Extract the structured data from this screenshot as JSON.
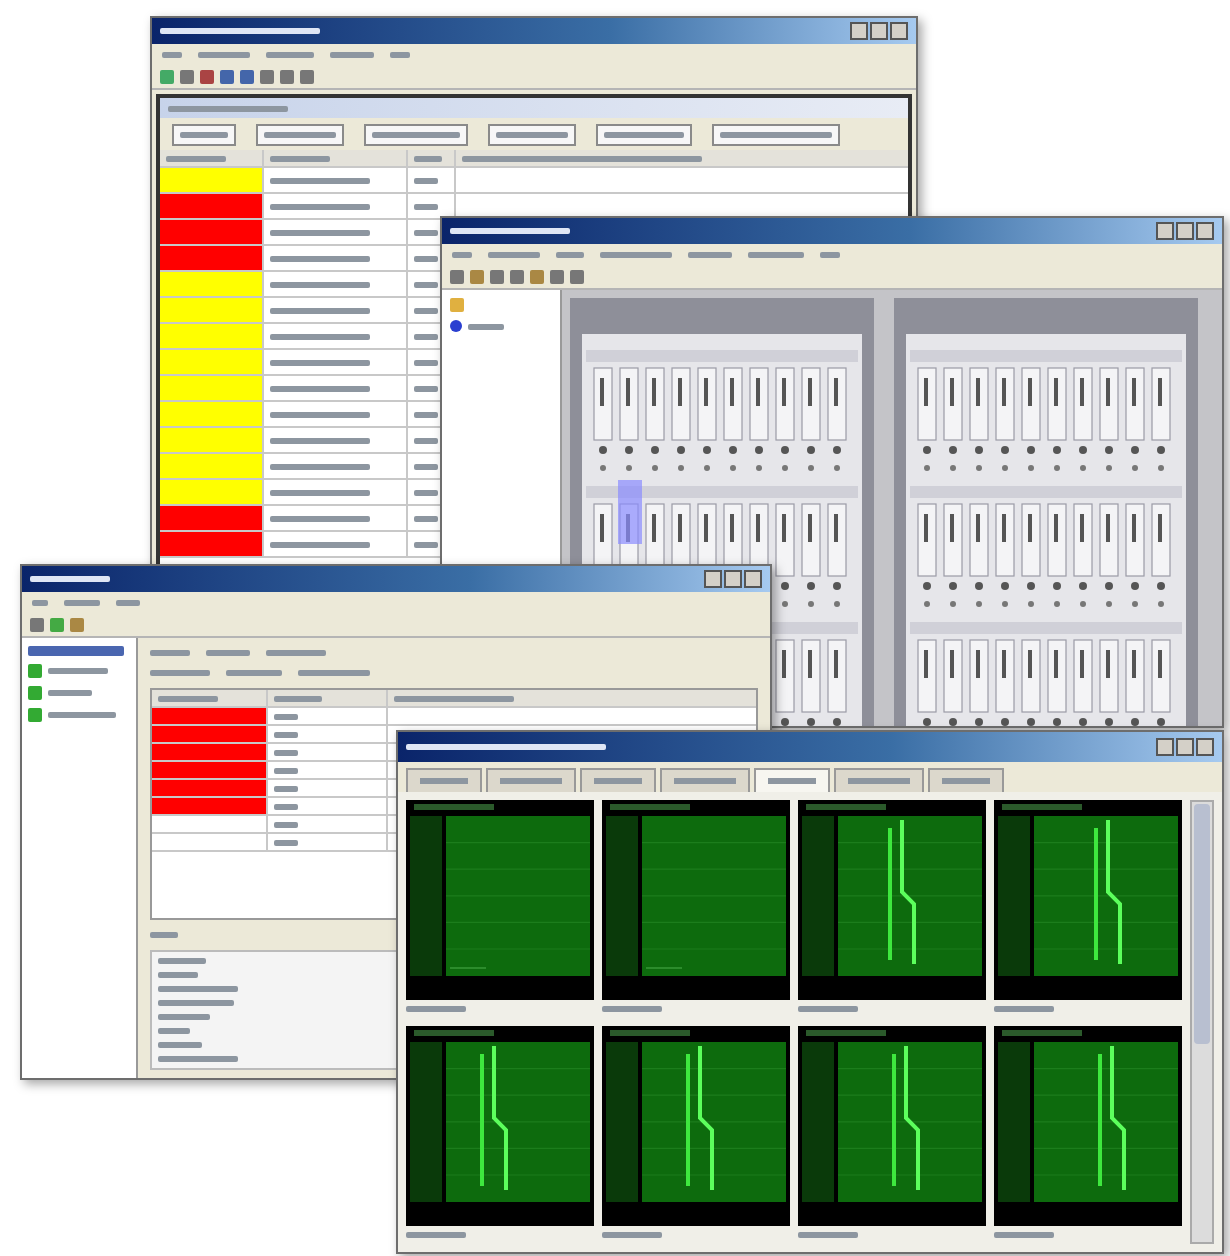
{
  "alarm_window": {
    "rows": [
      {
        "color": "#ffff00"
      },
      {
        "color": "#ff0000"
      },
      {
        "color": "#ff0000"
      },
      {
        "color": "#ff0000"
      },
      {
        "color": "#ffff00"
      },
      {
        "color": "#ffff00"
      },
      {
        "color": "#ffff00"
      },
      {
        "color": "#ffff00"
      },
      {
        "color": "#ffff00"
      },
      {
        "color": "#ffff00"
      },
      {
        "color": "#ffff00"
      },
      {
        "color": "#ffff00"
      },
      {
        "color": "#ffff00"
      },
      {
        "color": "#ff0000"
      },
      {
        "color": "#ff0000"
      }
    ]
  },
  "network_window": {
    "rows": [
      {
        "color": "#ff0000"
      },
      {
        "color": "#ff0000"
      },
      {
        "color": "#ff0000"
      },
      {
        "color": "#ff0000"
      },
      {
        "color": "#ff0000"
      },
      {
        "color": "#ff0000"
      },
      {
        "color": "#ffffff"
      },
      {
        "color": "#ffffff"
      }
    ]
  },
  "spectrum_window": {
    "tabs": [
      {
        "selected": false
      },
      {
        "selected": false
      },
      {
        "selected": false
      },
      {
        "selected": false
      },
      {
        "selected": true
      },
      {
        "selected": false
      },
      {
        "selected": false
      }
    ],
    "panels": [
      {
        "kind": "empty"
      },
      {
        "kind": "empty"
      },
      {
        "kind": "trace"
      },
      {
        "kind": "trace"
      },
      {
        "kind": "trace"
      },
      {
        "kind": "trace"
      },
      {
        "kind": "trace"
      },
      {
        "kind": "trace"
      }
    ]
  }
}
